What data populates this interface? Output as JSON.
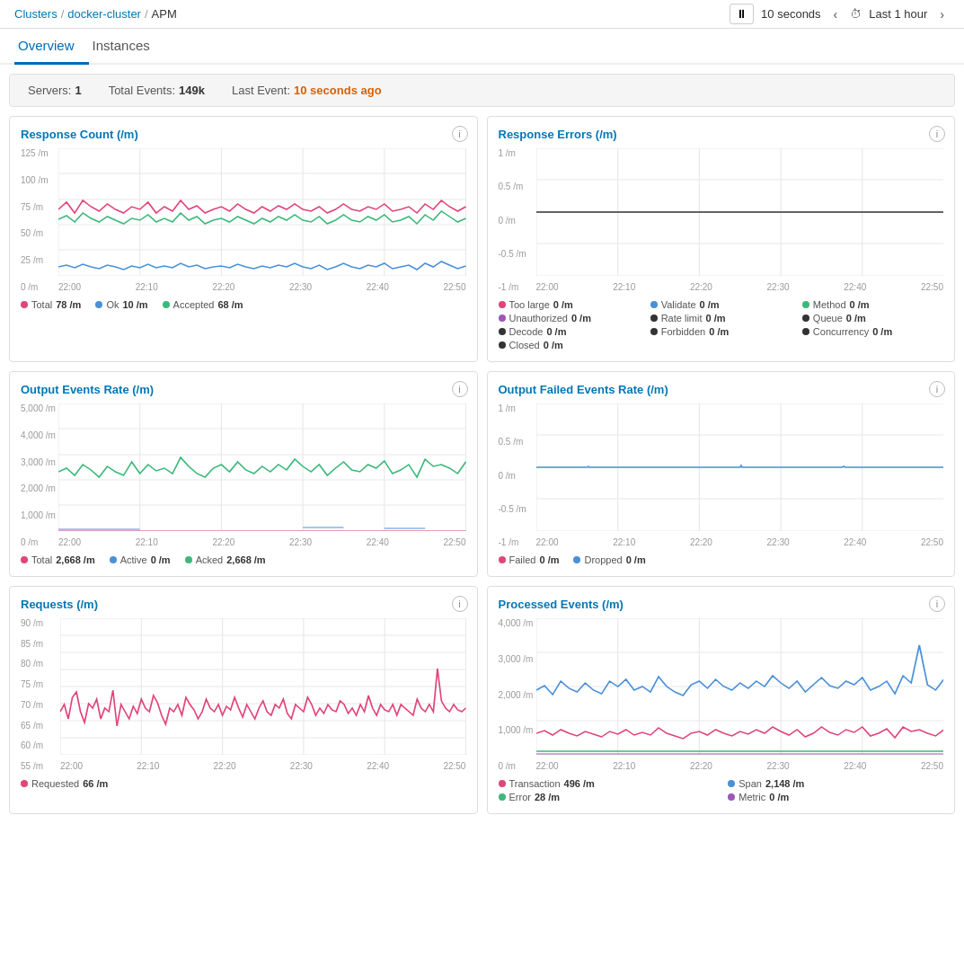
{
  "breadcrumb": {
    "clusters": "Clusters",
    "cluster_name": "docker-cluster",
    "current": "APM"
  },
  "top_controls": {
    "interval": "10 seconds",
    "time_range": "Last 1 hour"
  },
  "tabs": [
    {
      "id": "overview",
      "label": "Overview",
      "active": true
    },
    {
      "id": "instances",
      "label": "Instances",
      "active": false
    }
  ],
  "summary": {
    "servers_label": "Servers:",
    "servers_value": "1",
    "events_label": "Total Events:",
    "events_value": "149k",
    "last_event_label": "Last Event:",
    "last_event_value": "10 seconds ago"
  },
  "charts": [
    {
      "id": "response-count",
      "title": "Response Count (/m)",
      "y_labels": [
        "125 /m",
        "100 /m",
        "75 /m",
        "50 /m",
        "25 /m",
        "0 /m"
      ],
      "x_labels": [
        "22:00",
        "22:10",
        "22:20",
        "22:30",
        "22:40",
        "22:50"
      ],
      "legend": [
        {
          "label": "Total",
          "value": "78 /m",
          "color": "#e0457b"
        },
        {
          "label": "Ok",
          "value": "10 /m",
          "color": "#4a90d9"
        },
        {
          "label": "Accepted",
          "value": "68 /m",
          "color": "#3cb97a"
        }
      ],
      "series": [
        {
          "color": "#e0457b",
          "type": "line"
        },
        {
          "color": "#4a90d9",
          "type": "line"
        },
        {
          "color": "#3cb97a",
          "type": "line"
        }
      ]
    },
    {
      "id": "response-errors",
      "title": "Response Errors (/m)",
      "y_labels": [
        "1 /m",
        "0.5 /m",
        "0 /m",
        "-0.5 /m",
        "-1 /m"
      ],
      "x_labels": [
        "22:00",
        "22:10",
        "22:20",
        "22:30",
        "22:40",
        "22:50"
      ],
      "legend": [
        {
          "label": "Too large",
          "value": "0 /m",
          "color": "#e0457b"
        },
        {
          "label": "Unauthorized",
          "value": "0 /m",
          "color": "#9b59b6"
        },
        {
          "label": "Decode",
          "value": "0 /m",
          "color": "#333"
        },
        {
          "label": "Closed",
          "value": "0 /m",
          "color": "#333"
        },
        {
          "label": "Validate",
          "value": "0 /m",
          "color": "#4a90d9"
        },
        {
          "label": "Rate limit",
          "value": "0 /m",
          "color": "#333"
        },
        {
          "label": "Forbidden",
          "value": "0 /m",
          "color": "#333"
        },
        {
          "label": "Method",
          "value": "0 /m",
          "color": "#3cb97a"
        },
        {
          "label": "Queue",
          "value": "0 /m",
          "color": "#333"
        },
        {
          "label": "Concurrency",
          "value": "0 /m",
          "color": "#333"
        }
      ],
      "series": [
        {
          "color": "#333",
          "type": "line"
        }
      ]
    },
    {
      "id": "output-events-rate",
      "title": "Output Events Rate (/m)",
      "y_labels": [
        "5,000 /m",
        "4,000 /m",
        "3,000 /m",
        "2,000 /m",
        "1,000 /m",
        "0 /m"
      ],
      "x_labels": [
        "22:00",
        "22:10",
        "22:20",
        "22:30",
        "22:40",
        "22:50"
      ],
      "legend": [
        {
          "label": "Total",
          "value": "2,668 /m",
          "color": "#e0457b"
        },
        {
          "label": "Active",
          "value": "0 /m",
          "color": "#4a90d9"
        },
        {
          "label": "Acked",
          "value": "2,668 /m",
          "color": "#3cb97a"
        }
      ],
      "series": [
        {
          "color": "#3cb97a",
          "type": "line"
        }
      ]
    },
    {
      "id": "output-failed-events-rate",
      "title": "Output Failed Events Rate (/m)",
      "y_labels": [
        "1 /m",
        "0.5 /m",
        "0 /m",
        "-0.5 /m",
        "-1 /m"
      ],
      "x_labels": [
        "22:00",
        "22:10",
        "22:20",
        "22:30",
        "22:40",
        "22:50"
      ],
      "legend": [
        {
          "label": "Failed",
          "value": "0 /m",
          "color": "#e0457b"
        },
        {
          "label": "Dropped",
          "value": "0 /m",
          "color": "#4a90d9"
        }
      ],
      "series": [
        {
          "color": "#4a90d9",
          "type": "line"
        }
      ]
    },
    {
      "id": "requests",
      "title": "Requests (/m)",
      "y_labels": [
        "90 /m",
        "85 /m",
        "80 /m",
        "75 /m",
        "70 /m",
        "65 /m",
        "60 /m",
        "55 /m"
      ],
      "x_labels": [
        "22:00",
        "22:10",
        "22:20",
        "22:30",
        "22:40",
        "22:50"
      ],
      "legend": [
        {
          "label": "Requested",
          "value": "66 /m",
          "color": "#e0457b"
        }
      ],
      "series": [
        {
          "color": "#e0457b",
          "type": "line"
        }
      ]
    },
    {
      "id": "processed-events",
      "title": "Processed Events (/m)",
      "y_labels": [
        "4,000 /m",
        "3,000 /m",
        "2,000 /m",
        "1,000 /m",
        "0 /m"
      ],
      "x_labels": [
        "22:00",
        "22:10",
        "22:20",
        "22:30",
        "22:40",
        "22:50"
      ],
      "legend": [
        {
          "label": "Transaction",
          "value": "496 /m",
          "color": "#e0457b"
        },
        {
          "label": "Span",
          "value": "2,148 /m",
          "color": "#4a90d9"
        },
        {
          "label": "Error",
          "value": "28 /m",
          "color": "#3cb97a"
        },
        {
          "label": "Metric",
          "value": "0 /m",
          "color": "#9b59b6"
        }
      ],
      "series": [
        {
          "color": "#4a90d9",
          "type": "line"
        },
        {
          "color": "#e0457b",
          "type": "line"
        }
      ]
    }
  ],
  "icons": {
    "pause": "⏸",
    "clock": "🕐",
    "chevron_left": "‹",
    "chevron_right": "›",
    "info": "i"
  }
}
